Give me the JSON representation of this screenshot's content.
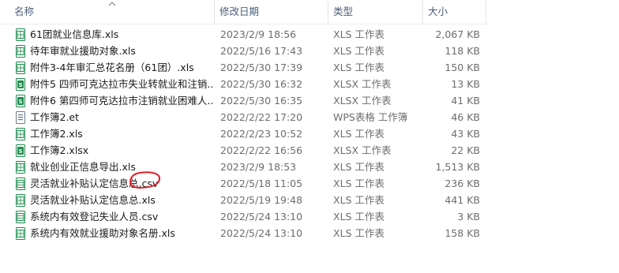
{
  "columns": {
    "name": "名称",
    "date": "修改日期",
    "type": "类型",
    "size": "大小"
  },
  "colors": {
    "xls_icon": "#1d8c4c",
    "wps_icon": "#6b7a8c",
    "annotation": "#e0202a"
  },
  "files": [
    {
      "name": "61团就业信息库.xls",
      "date": "2023/2/9 18:56",
      "type": "XLS 工作表",
      "size": "2,067 KB",
      "icon": "xls-file-icon"
    },
    {
      "name": "待年审就业援助对象.xls",
      "date": "2022/5/16 17:43",
      "type": "XLS 工作表",
      "size": "118 KB",
      "icon": "xls-file-icon"
    },
    {
      "name": "附件3-4年审汇总花名册（61团）.xls",
      "date": "2022/5/30 17:39",
      "type": "XLS 工作表",
      "size": "150 KB",
      "icon": "xls-file-icon"
    },
    {
      "name": "附件5 四师可克达拉市失业转就业和注销...",
      "date": "2022/5/30 16:32",
      "type": "XLSX 工作表",
      "size": "13 KB",
      "icon": "xlsx-file-icon"
    },
    {
      "name": "附件6 第四师可克达拉市注销就业困难人...",
      "date": "2022/5/30 16:35",
      "type": "XLSX 工作表",
      "size": "41 KB",
      "icon": "xlsx-file-icon"
    },
    {
      "name": "工作簿2.et",
      "date": "2022/2/22 17:20",
      "type": "WPS表格 工作簿",
      "size": "46 KB",
      "icon": "et-file-icon"
    },
    {
      "name": "工作簿2.xls",
      "date": "2022/2/23 10:52",
      "type": "XLS 工作表",
      "size": "43 KB",
      "icon": "xls-file-icon"
    },
    {
      "name": "工作簿2.xlsx",
      "date": "2022/2/22 16:56",
      "type": "XLSX 工作表",
      "size": "22 KB",
      "icon": "xlsx-file-icon"
    },
    {
      "name": "就业创业正信息导出.xls",
      "date": "2023/2/9 18:53",
      "type": "XLS 工作表",
      "size": "1,513 KB",
      "icon": "xls-file-icon"
    },
    {
      "name": "灵活就业补贴认定信息总.csv",
      "date": "2022/5/18 11:05",
      "type": "XLS 工作表",
      "size": "236 KB",
      "icon": "csv-file-icon"
    },
    {
      "name": "灵活就业补贴认定信息总.xls",
      "date": "2022/5/19 19:48",
      "type": "XLS 工作表",
      "size": "441 KB",
      "icon": "xls-file-icon"
    },
    {
      "name": "系统内有效登记失业人员.csv",
      "date": "2022/5/24 13:10",
      "type": "XLS 工作表",
      "size": "3 KB",
      "icon": "csv-file-icon"
    },
    {
      "name": "系统内有效就业援助对象名册.xls",
      "date": "2022/5/24 13:10",
      "type": "XLS 工作表",
      "size": "158 KB",
      "icon": "xls-file-icon"
    }
  ]
}
